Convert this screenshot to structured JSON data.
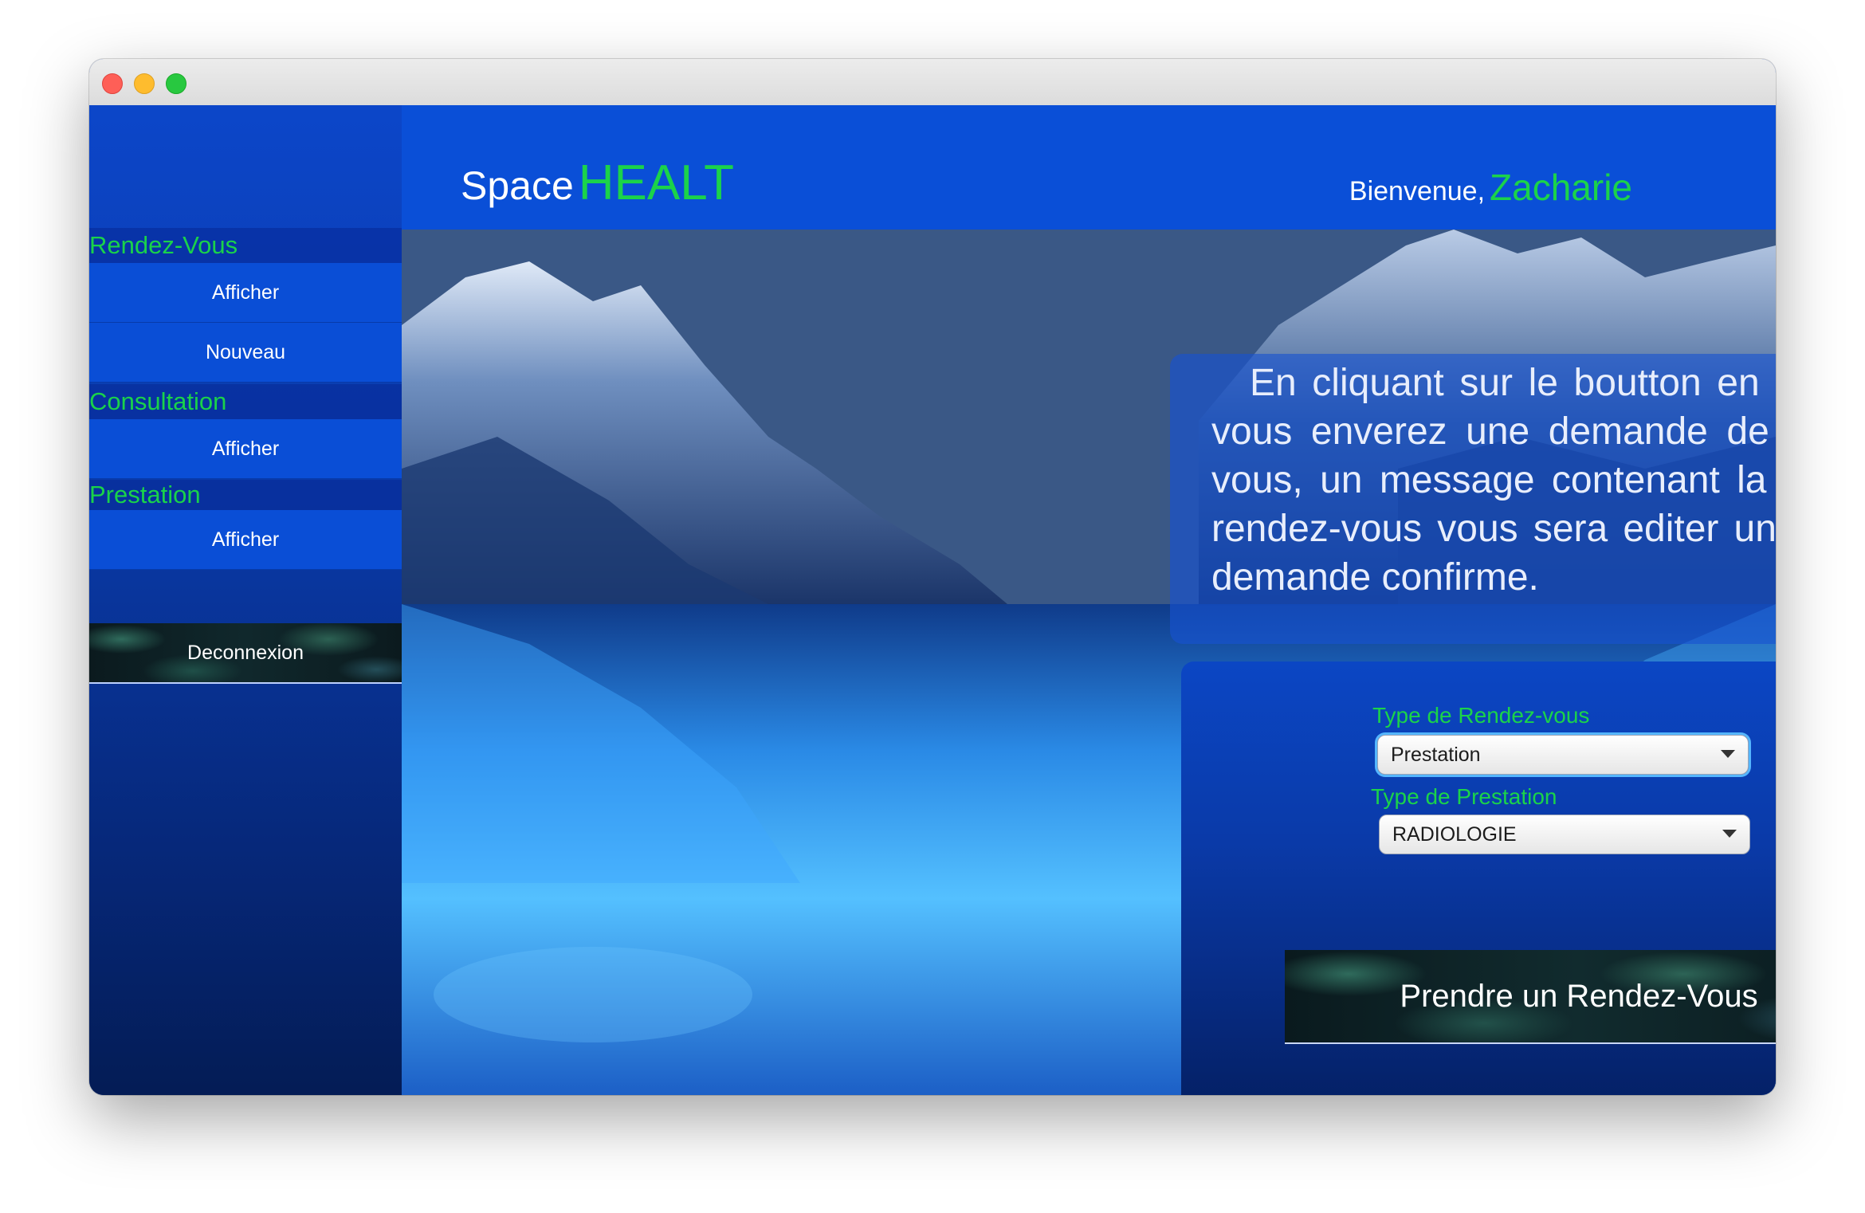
{
  "brand": {
    "part1": "Space",
    "part2": "HEALT"
  },
  "header": {
    "welcome": "Bienvenue,",
    "user": "Zacharie"
  },
  "sidebar": {
    "sections": [
      {
        "title": "Rendez-Vous",
        "items": [
          "Afficher",
          "Nouveau"
        ]
      },
      {
        "title": "Consultation",
        "items": [
          "Afficher"
        ]
      },
      {
        "title": "Prestation",
        "items": [
          "Afficher"
        ]
      }
    ],
    "logout": "Deconnexion"
  },
  "info": {
    "text": "En cliquant sur le boutton en dessous vous enverez une demande de rendez-vous, un message contenant la date  du rendez-vous vous sera editer une fois le demande confirme."
  },
  "form": {
    "type_label": "Type de Rendez-vous",
    "type_value": "Prestation",
    "prestation_label": "Type de Prestation",
    "prestation_value": "RADIOLOGIE",
    "submit": "Prendre un Rendez-Vous"
  },
  "colors": {
    "accent_green": "#1bd34a",
    "primary_blue": "#0a4fd7",
    "dark_navy": "#041c55"
  }
}
